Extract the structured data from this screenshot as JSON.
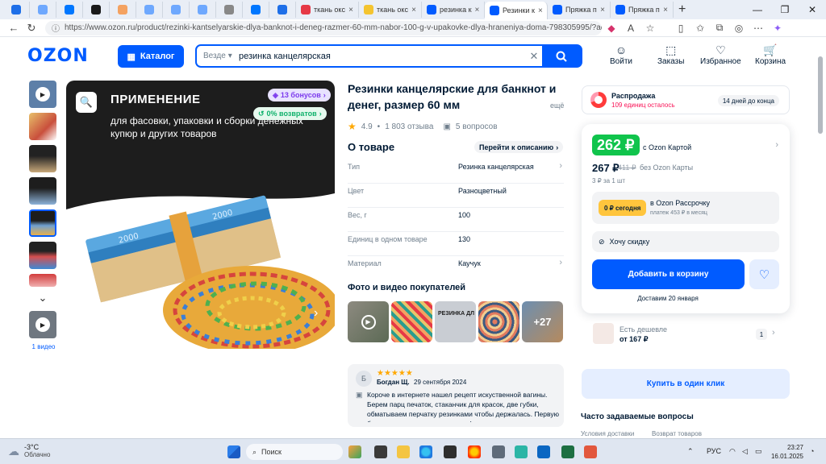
{
  "browser": {
    "tabs": [
      {
        "label": "",
        "fav_color": "#1e6fe8",
        "type": "small"
      },
      {
        "label": "",
        "fav_color": "#6ea8fe",
        "type": "small"
      },
      {
        "label": "",
        "fav_color": "#0077ff",
        "type": "small"
      },
      {
        "label": "",
        "fav_color": "#1a1a1a",
        "type": "small"
      },
      {
        "label": "",
        "fav_color": "#f4a261",
        "type": "small"
      },
      {
        "label": "",
        "fav_color": "#6ea8fe",
        "type": "small"
      },
      {
        "label": "",
        "fav_color": "#6ea8fe",
        "type": "small"
      },
      {
        "label": "",
        "fav_color": "#6ea8fe",
        "type": "small"
      },
      {
        "label": "",
        "fav_color": "#888888",
        "type": "small"
      },
      {
        "label": "",
        "fav_color": "#0077ff",
        "type": "small"
      },
      {
        "label": "",
        "fav_color": "#1e6fe8",
        "type": "small"
      },
      {
        "label": "ткань окс",
        "fav_color": "#e63946",
        "type": "wide"
      },
      {
        "label": "ткань окс",
        "fav_color": "#f4c430",
        "type": "wide"
      },
      {
        "label": "резинка к",
        "fav_color": "#005bff",
        "type": "wide"
      },
      {
        "label": "Резинки к",
        "fav_color": "#005bff",
        "type": "wide",
        "active": true
      },
      {
        "label": "Пряжка п",
        "fav_color": "#005bff",
        "type": "wide"
      },
      {
        "label": "Пряжка п",
        "fav_color": "#005bff",
        "type": "wide"
      }
    ],
    "tab_close": "×",
    "new_tab": "+",
    "window_controls": [
      "—",
      "❐",
      "✕"
    ],
    "url": "https://www.ozon.ru/product/rezinki-kantselyarskie-dlya-banknot-i-deneg-razmer-60-mm-nabor-100-g-v-upakovke-dlya-hraneniya-doma-798305995/?adver..."
  },
  "header": {
    "logo": "OZON",
    "catalog_label": "Каталог",
    "search_scope": "Везде",
    "search_value": "резинка канцелярская",
    "nav": [
      {
        "label": "Войти",
        "icon": "☺"
      },
      {
        "label": "Заказы",
        "icon": "⬚"
      },
      {
        "label": "Избранное",
        "icon": "♡"
      },
      {
        "label": "Корзина",
        "icon": "🛒"
      }
    ]
  },
  "gallery": {
    "video_label": "1 видео",
    "headline": "ПРИМЕНЕНИЕ",
    "subline": "для фасовки, упаковки и сборки денежных купюр и других товаров",
    "bonus_badge": "13 бонусов",
    "return_badge": "0% возвратов"
  },
  "product": {
    "title": "Резинки канцелярские для банкнот и денег, размер 60 мм",
    "more": "ещё",
    "rating": "4.9",
    "reviews": "1 803 отзыва",
    "questions": "5 вопросов",
    "about_title": "О товаре",
    "to_description": "Перейти к описанию",
    "specs": [
      {
        "key": "Тип",
        "value": "Резинка канцелярская",
        "arrow": true
      },
      {
        "key": "Цвет",
        "value": "Разноцветный",
        "arrow": false
      },
      {
        "key": "Вес, г",
        "value": "100",
        "arrow": false
      },
      {
        "key": "Единиц в одном товаре",
        "value": "130",
        "arrow": false
      },
      {
        "key": "Материал",
        "value": "Каучук",
        "arrow": true
      }
    ],
    "photos_title": "Фото и видео покупателей",
    "photos_more": "+27",
    "photo_label": "РЕЗИНКА ДЛ"
  },
  "review": {
    "avatar_letter": "Б",
    "stars": "★★★★★",
    "author": "Богдан Щ.",
    "date": "29 сентября 2024",
    "text": "Короче в интернете нашел рецепт искуственной вагины. Берем парц печаток, стаканчик для красок, две губки, обматываем перчатку резинками чтобы держалась. Первую бронную ночь резинки перекили!"
  },
  "sidebar": {
    "sale_title": "Распродажа",
    "sale_sub": "109 единиц осталось",
    "sale_days": "14 дней до конца",
    "card_price": "262 ₽",
    "card_price_label": "с Ozon Картой",
    "price": "267 ₽",
    "old_price": "411 ₽",
    "price_label": "без Ozon Карты",
    "per_unit": "3 ₽ за 1 шт",
    "installment_pill": "0 ₽ сегодня",
    "installment_title": "в Ozon Рассрочку",
    "installment_sub": "платеж 453 ₽ в месяц",
    "discount_label": "Хочу скидку",
    "add_to_cart": "Добавить в корзину",
    "delivery": "Доставим 20 января",
    "cheaper_label": "Есть дешевле",
    "cheaper_price": "от 167 ₽",
    "cheaper_count": "1",
    "one_click": "Купить в один клик",
    "faq": "Часто задаваемые вопросы",
    "faq_items": [
      "Условия доставки",
      "Возврат товаров"
    ]
  },
  "taskbar": {
    "temp": "-3°C",
    "weather": "Облачно",
    "search": "Поиск",
    "lang": "РУС",
    "time": "23:27",
    "date": "16.01.2025"
  }
}
